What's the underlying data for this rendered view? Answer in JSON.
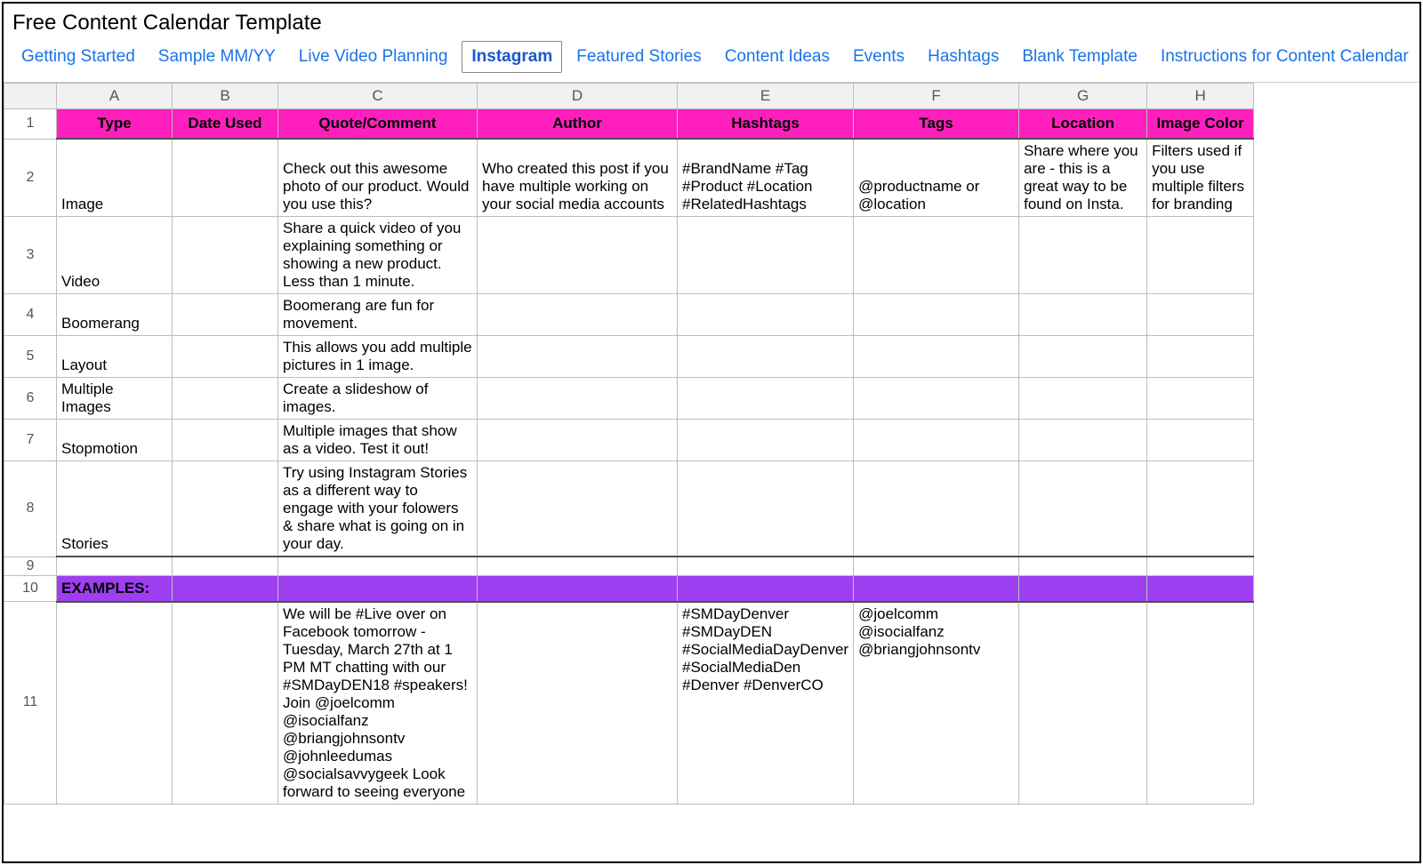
{
  "title": "Free Content Calendar Template",
  "tabs": [
    {
      "label": "Getting Started",
      "active": false
    },
    {
      "label": "Sample MM/YY",
      "active": false
    },
    {
      "label": "Live Video Planning",
      "active": false
    },
    {
      "label": "Instagram",
      "active": true
    },
    {
      "label": "Featured Stories",
      "active": false
    },
    {
      "label": "Content Ideas",
      "active": false
    },
    {
      "label": "Events",
      "active": false
    },
    {
      "label": "Hashtags",
      "active": false
    },
    {
      "label": "Blank Template",
      "active": false
    },
    {
      "label": "Instructions for Content Calendar",
      "active": false
    }
  ],
  "columns": [
    "A",
    "B",
    "C",
    "D",
    "E",
    "F",
    "G",
    "H"
  ],
  "headers": [
    "Type",
    "Date Used",
    "Quote/Comment",
    "Author",
    "Hashtags",
    "Tags",
    "Location",
    "Image Color"
  ],
  "rows": [
    {
      "n": 2,
      "cells": [
        "Image",
        "",
        "Check out this awesome photo of our product. Would you use this?",
        "Who created this post if you have multiple working on your social media accounts",
        "#BrandName #Tag #Product #Location #RelatedHashtags",
        "@productname or @location",
        "Share where you are - this is a great way to be found on Insta.",
        "Filters used if you use multiple filters for branding"
      ]
    },
    {
      "n": 3,
      "cells": [
        "Video",
        "",
        "Share a quick video of you explaining something or showing a new product. Less than 1 minute.",
        "",
        "",
        "",
        "",
        ""
      ]
    },
    {
      "n": 4,
      "cells": [
        "Boomerang",
        "",
        "Boomerang are fun for movement.",
        "",
        "",
        "",
        "",
        ""
      ]
    },
    {
      "n": 5,
      "cells": [
        "Layout",
        "",
        "This allows you add multiple pictures in 1 image.",
        "",
        "",
        "",
        "",
        ""
      ]
    },
    {
      "n": 6,
      "cells": [
        "Multiple Images",
        "",
        "Create a slideshow of images.",
        "",
        "",
        "",
        "",
        ""
      ]
    },
    {
      "n": 7,
      "cells": [
        "Stopmotion",
        "",
        "Multiple images that show as a video. Test it out!",
        "",
        "",
        "",
        "",
        ""
      ]
    },
    {
      "n": 8,
      "cells": [
        "Stories",
        "",
        "Try using Instagram Stories as a different way to engage with your folowers & share what is going on in your day.",
        "",
        "",
        "",
        "",
        ""
      ]
    }
  ],
  "blankRow": 9,
  "examplesLabel": "EXAMPLES:",
  "examplesRow": 10,
  "exampleDataRow": {
    "n": 11,
    "cells": [
      "",
      "",
      "We will be #Live over on Facebook tomorrow - Tuesday, March 27th at 1 PM MT chatting with our #SMDayDEN18 #speakers! Join @joelcomm @isocialfanz @briangjohnsontv @johnleedumas @socialsavvygeek Look forward to seeing everyone",
      "",
      "#SMDayDenver #SMDayDEN #SocialMediaDayDenver #SocialMediaDen #Denver #DenverCO",
      "@joelcomm @isocialfanz @briangjohnsontv",
      "",
      ""
    ]
  }
}
